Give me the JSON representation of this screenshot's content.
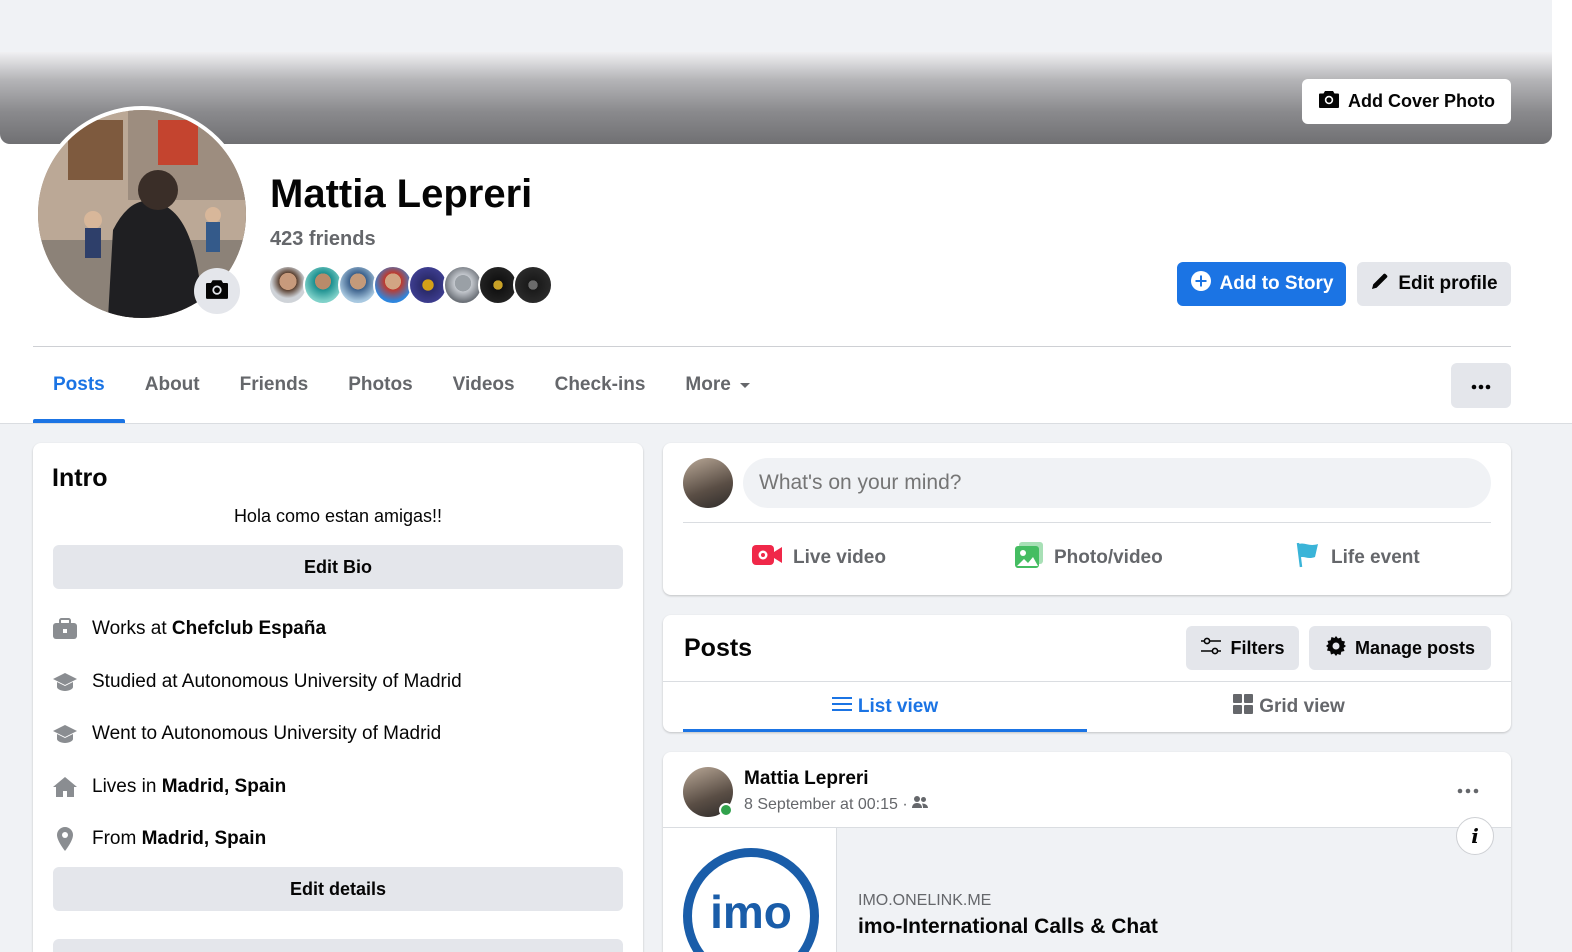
{
  "cover": {
    "add_cover_label": "Add Cover Photo"
  },
  "profile": {
    "name": "Mattia Lepreri",
    "friends_count": "423 friends"
  },
  "actions": {
    "add_story": "Add to Story",
    "edit_profile": "Edit profile"
  },
  "tabs": [
    {
      "label": "Posts",
      "active": true
    },
    {
      "label": "About"
    },
    {
      "label": "Friends"
    },
    {
      "label": "Photos"
    },
    {
      "label": "Videos"
    },
    {
      "label": "Check-ins"
    },
    {
      "label": "More"
    }
  ],
  "intro": {
    "title": "Intro",
    "bio": "Hola como estan amigas!!",
    "edit_bio": "Edit Bio",
    "rows": [
      {
        "icon": "briefcase-icon",
        "prefix": "Works at ",
        "bold": "Chefclub España"
      },
      {
        "icon": "graduation-cap-icon",
        "prefix": "Studied at Autonomous University of Madrid",
        "bold": ""
      },
      {
        "icon": "graduation-cap-icon",
        "prefix": "Went to Autonomous University of Madrid",
        "bold": ""
      },
      {
        "icon": "home-icon",
        "prefix": "Lives in ",
        "bold": "Madrid, Spain"
      },
      {
        "icon": "location-pin-icon",
        "prefix": "From ",
        "bold": "Madrid, Spain"
      }
    ],
    "edit_details": "Edit details"
  },
  "composer": {
    "placeholder": "What's on your mind?",
    "live_video": "Live video",
    "photo_video": "Photo/video",
    "life_event": "Life event"
  },
  "posts": {
    "title": "Posts",
    "filters": "Filters",
    "manage": "Manage posts",
    "list_view": "List view",
    "grid_view": "Grid view"
  },
  "post": {
    "author": "Mattia Lepreri",
    "time": "8 September at 00:15 ·",
    "link_domain": "IMO.ONELINK.ME",
    "link_title": "imo-International Calls & Chat",
    "thumb_text": "imo"
  },
  "colors": {
    "accent": "#1b74e4",
    "live": "#f02849",
    "photo": "#45bd62",
    "life": "#3ab4d8"
  }
}
